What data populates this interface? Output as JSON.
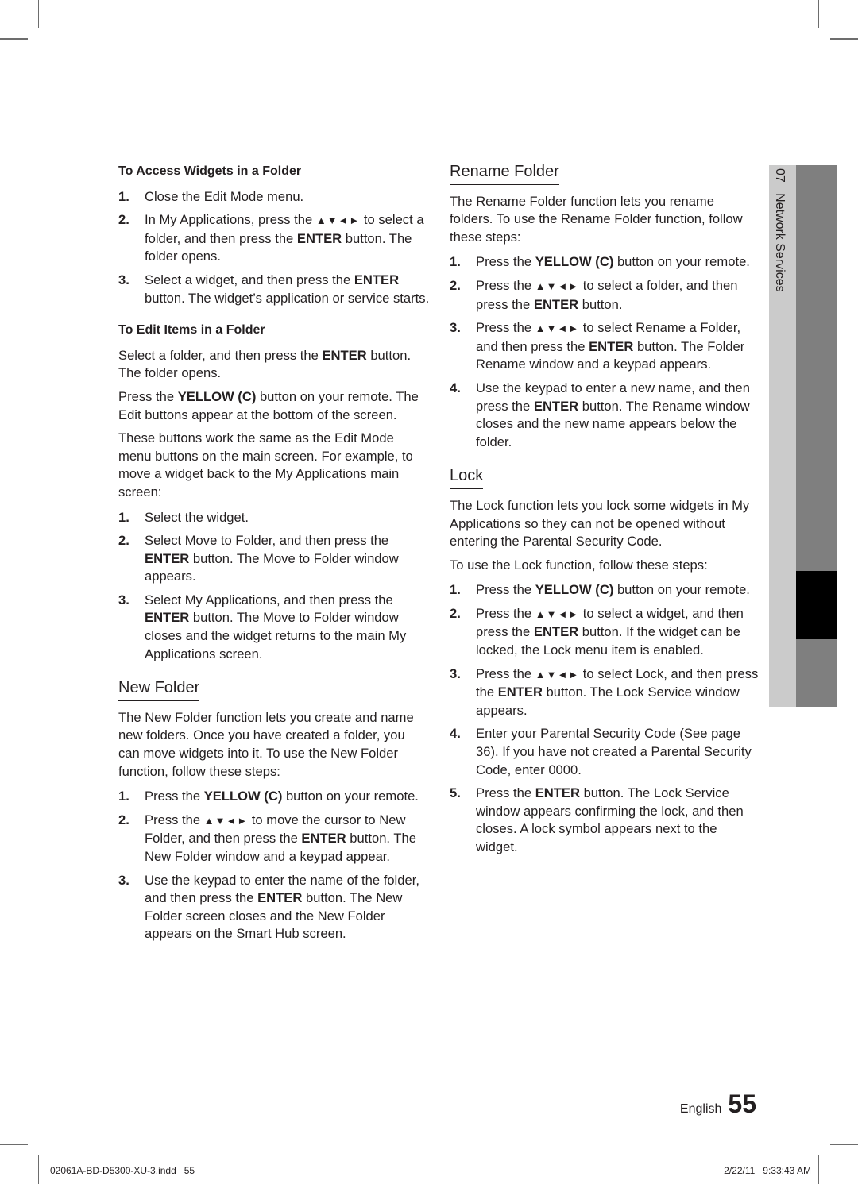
{
  "left": {
    "access": {
      "heading": "To Access Widgets in a Folder",
      "steps": [
        [
          {
            "t": "Close the Edit Mode menu."
          }
        ],
        [
          {
            "t": "In My Applications, press the "
          },
          {
            "a": "▲▼◄►"
          },
          {
            "t": " to select a folder, and then press the "
          },
          {
            "b": "ENTER"
          },
          {
            "t": " button. The folder opens."
          }
        ],
        [
          {
            "t": "Select a widget, and then press the "
          },
          {
            "b": "ENTER"
          },
          {
            "t": " button. The widget’s application or service starts."
          }
        ]
      ]
    },
    "edit": {
      "heading": "To Edit Items in a Folder",
      "paras": [
        [
          {
            "t": "Select a folder, and then press the "
          },
          {
            "b": "ENTER"
          },
          {
            "t": " button. The folder opens."
          }
        ],
        [
          {
            "t": "Press the "
          },
          {
            "b": "YELLOW (C)"
          },
          {
            "t": " button on your remote. The Edit buttons appear at the bottom of the screen."
          }
        ],
        [
          {
            "t": "These buttons work the same as the Edit Mode menu buttons on the main screen. For example, to move a widget back to the My Applications main screen:"
          }
        ]
      ],
      "steps": [
        [
          {
            "t": "Select the widget."
          }
        ],
        [
          {
            "t": "Select Move to Folder, and then press the "
          },
          {
            "b": "ENTER"
          },
          {
            "t": " button. The Move to Folder window appears."
          }
        ],
        [
          {
            "t": "Select My Applications, and then press the "
          },
          {
            "b": "ENTER"
          },
          {
            "t": " button. The Move to Folder window closes and the widget returns to the main My Applications screen."
          }
        ]
      ]
    },
    "newfolder": {
      "heading": "New Folder",
      "paras": [
        [
          {
            "t": "The New Folder function lets you create and name new folders. Once you have created a folder, you can move widgets into it. To use the New Folder function, follow these steps:"
          }
        ]
      ],
      "steps": [
        [
          {
            "t": "Press the "
          },
          {
            "b": "YELLOW (C)"
          },
          {
            "t": " button on your remote."
          }
        ],
        [
          {
            "t": "Press the "
          },
          {
            "a": "▲▼◄►"
          },
          {
            "t": " to move the cursor to New Folder, and then press the "
          },
          {
            "b": "ENTER"
          },
          {
            "t": " button. The  New Folder window and a keypad appear."
          }
        ],
        [
          {
            "t": "Use the keypad to enter the name of the folder, and then press the "
          },
          {
            "b": "ENTER"
          },
          {
            "t": " button. The New Folder screen closes and the New Folder appears on the Smart Hub screen."
          }
        ]
      ]
    }
  },
  "right": {
    "rename": {
      "heading": "Rename Folder",
      "paras": [
        [
          {
            "t": "The Rename Folder function lets you rename folders. To use the Rename Folder function, follow these steps:"
          }
        ]
      ],
      "steps": [
        [
          {
            "t": "Press the "
          },
          {
            "b": "YELLOW (C)"
          },
          {
            "t": " button on your remote."
          }
        ],
        [
          {
            "t": "Press the "
          },
          {
            "a": "▲▼◄►"
          },
          {
            "t": " to select a folder, and then press the "
          },
          {
            "b": "ENTER"
          },
          {
            "t": " button."
          }
        ],
        [
          {
            "t": "Press the "
          },
          {
            "a": "▲▼◄►"
          },
          {
            "t": " to select Rename a Folder, and then press the "
          },
          {
            "b": "ENTER"
          },
          {
            "t": " button. The Folder Rename window and a keypad appears."
          }
        ],
        [
          {
            "t": "Use the keypad to enter a new name, and then press the "
          },
          {
            "b": "ENTER"
          },
          {
            "t": " button. The Rename window closes and the new name appears below the folder."
          }
        ]
      ]
    },
    "lock": {
      "heading": "Lock",
      "paras": [
        [
          {
            "t": "The Lock function lets you lock some widgets in My Applications so they can not be opened without entering the Parental Security Code."
          }
        ],
        [
          {
            "t": "To use the Lock function, follow these steps:"
          }
        ]
      ],
      "steps": [
        [
          {
            "t": "Press the "
          },
          {
            "b": "YELLOW (C)"
          },
          {
            "t": " button on your remote."
          }
        ],
        [
          {
            "t": "Press the "
          },
          {
            "a": "▲▼◄►"
          },
          {
            "t": " to select a widget, and then press the "
          },
          {
            "b": "ENTER"
          },
          {
            "t": " button. If the widget can be locked, the Lock menu item is enabled."
          }
        ],
        [
          {
            "t": "Press the "
          },
          {
            "a": "▲▼◄►"
          },
          {
            "t": " to select Lock, and then press the "
          },
          {
            "b": "ENTER"
          },
          {
            "t": " button. The Lock Service window appears."
          }
        ],
        [
          {
            "t": "Enter your Parental Security Code (See page 36). If you have not created a Parental Security Code, enter 0000."
          }
        ],
        [
          {
            "t": "Press the "
          },
          {
            "b": "ENTER"
          },
          {
            "t": " button. The Lock Service window appears confirming the lock, and then closes. A lock symbol appears next to the widget."
          }
        ]
      ]
    }
  },
  "chapter": {
    "label": "07   Network Services"
  },
  "footer": {
    "language": "English",
    "page_number": "55",
    "slug_file": "02061A-BD-D5300-XU-3.indd   55",
    "slug_date": "2/22/11   9:33:43 AM"
  },
  "colors": {
    "tab_light": "#cbcbcb",
    "tab_dark": "#7f7f7f",
    "tab_marker": "#000000"
  }
}
